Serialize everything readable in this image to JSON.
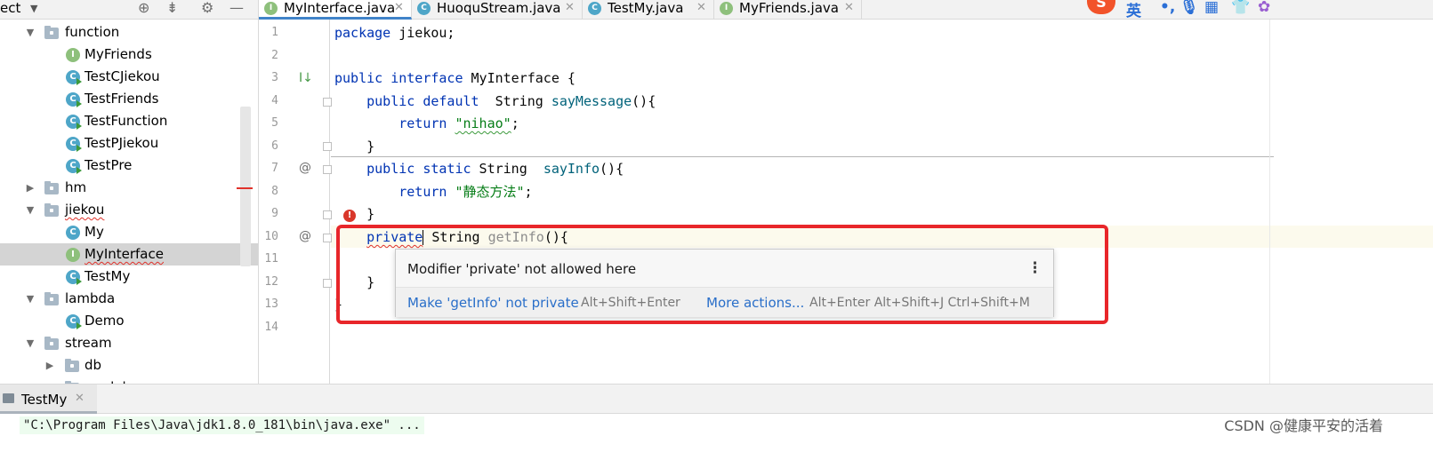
{
  "project_panel": {
    "title": "ect",
    "tree": [
      {
        "label": "function",
        "type": "folder",
        "expanded": true,
        "depth": 1
      },
      {
        "label": "MyFriends",
        "type": "interface",
        "depth": 2
      },
      {
        "label": "TestCJiekou",
        "type": "class",
        "depth": 2
      },
      {
        "label": "TestFriends",
        "type": "class",
        "depth": 2
      },
      {
        "label": "TestFunction",
        "type": "class",
        "depth": 2
      },
      {
        "label": "TestPJiekou",
        "type": "class",
        "depth": 2
      },
      {
        "label": "TestPre",
        "type": "class",
        "depth": 2
      },
      {
        "label": "hm",
        "type": "folder",
        "expanded": false,
        "depth": 1
      },
      {
        "label": "jiekou",
        "type": "folder",
        "expanded": true,
        "depth": 1,
        "error": true
      },
      {
        "label": "My",
        "type": "class",
        "depth": 2
      },
      {
        "label": "MyInterface",
        "type": "interface",
        "depth": 2,
        "selected": true,
        "error": true
      },
      {
        "label": "TestMy",
        "type": "class",
        "depth": 2
      },
      {
        "label": "lambda",
        "type": "folder",
        "expanded": true,
        "depth": 1
      },
      {
        "label": "Demo",
        "type": "class",
        "depth": 2
      },
      {
        "label": "stream",
        "type": "folder",
        "expanded": true,
        "depth": 1
      },
      {
        "label": "db",
        "type": "folder",
        "expanded": false,
        "depth": 2
      },
      {
        "label": "model",
        "type": "folder",
        "expanded": false,
        "depth": 2
      }
    ]
  },
  "tabs": [
    {
      "label": "MyInterface.java",
      "type": "interface",
      "active": true
    },
    {
      "label": "HuoquStream.java",
      "type": "class",
      "active": false
    },
    {
      "label": "TestMy.java",
      "type": "class",
      "active": false
    },
    {
      "label": "MyFriends.java",
      "type": "interface",
      "active": false
    }
  ],
  "ime_toolbar": {
    "logo": "S",
    "lang": "英",
    "punct": "•,"
  },
  "editor": {
    "line_numbers": [
      "1",
      "2",
      "3",
      "4",
      "5",
      "6",
      "7",
      "8",
      "9",
      "10",
      "11",
      "12",
      "13",
      "14"
    ],
    "lines": {
      "l1_kw": "package",
      "l1_rest": " jiekou;",
      "l3_kw": "public interface",
      "l3_rest": " MyInterface {",
      "l4_kw1": "public",
      "l4_kw2": "default",
      "l4_type": "  String ",
      "l4_fn": "sayMessage",
      "l4_rest": "(){",
      "l5_kw": "return",
      "l5_str": "\"nihao\"",
      "l5_rest": ";",
      "l6": "}",
      "l7_kw1": "public",
      "l7_kw2": "static",
      "l7_type": " String  ",
      "l7_fn": "sayInfo",
      "l7_rest": "(){",
      "l8_kw": "return",
      "l8_str": "\"静态方法\"",
      "l8_rest": ";",
      "l9": "}",
      "l10_kw": "private",
      "l10_type": " String ",
      "l10_fn": "getInfo",
      "l10_rest": "(){",
      "l12": "}",
      "l13": "}"
    },
    "gutter_marks": {
      "line3": "I↓",
      "line7": "@",
      "line10": "@"
    }
  },
  "popup": {
    "message": "Modifier 'private' not allowed here",
    "fix_label": "Make 'getInfo' not private",
    "fix_shortcut": "Alt+Shift+Enter",
    "more_label": "More actions...",
    "more_shortcut": "Alt+Enter Alt+Shift+J Ctrl+Shift+M",
    "menu_glyph": "⋮"
  },
  "run_panel": {
    "tab_label": "TestMy",
    "console_text": "\"C:\\Program Files\\Java\\jdk1.8.0_181\\bin\\java.exe\" ..."
  },
  "watermark": "CSDN @健康平安的活着",
  "colors": {
    "keyword": "#0033b3",
    "string": "#067d17",
    "method": "#00627a",
    "error": "#e0322b",
    "link": "#2a6fc9",
    "highlight_box": "#e8262a"
  }
}
